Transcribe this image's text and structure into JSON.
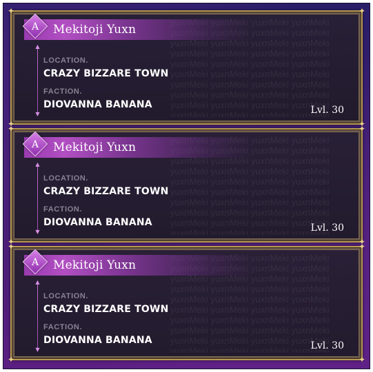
{
  "cards": [
    {
      "rank": "A",
      "name": "Mekitoji Yuxn",
      "location_label": "LOCATION.",
      "location": "CRAZY BIZZARE TOWN",
      "faction_label": "FACTION.",
      "faction": "DIOVANNA BANANA",
      "level": "Lvl. 30",
      "watermark": "yuxnMeki yuxnMeki yuxnMeki yuxnMeki"
    },
    {
      "rank": "A",
      "name": "Mekitoji Yuxn",
      "location_label": "LOCATION.",
      "location": "CRAZY BIZZARE TOWN",
      "faction_label": "FACTION.",
      "faction": "DIOVANNA BANANA",
      "level": "Lvl. 30",
      "watermark": "yuxnMeki yuxnMeki yuxnMeki yuxnMeki"
    },
    {
      "rank": "A",
      "name": "Mekitoji Yuxn",
      "location_label": "LOCATION.",
      "location": "CRAZY BIZZARE TOWN",
      "faction_label": "FACTION.",
      "faction": "DIOVANNA BANANA",
      "level": "Lvl. 30",
      "watermark": "yuxnMeki yuxnMeki yuxnMeki yuxnMeki"
    }
  ],
  "colors": {
    "accent": "#b14fc2",
    "gold_border": "#b89a52",
    "label": "#8a8194",
    "card_bg": "#282034"
  },
  "icons": {
    "rank_badge": "diamond-badge-icon",
    "corner": "corner-ornament-icon",
    "line_marker": "arrow-marker-icon"
  }
}
